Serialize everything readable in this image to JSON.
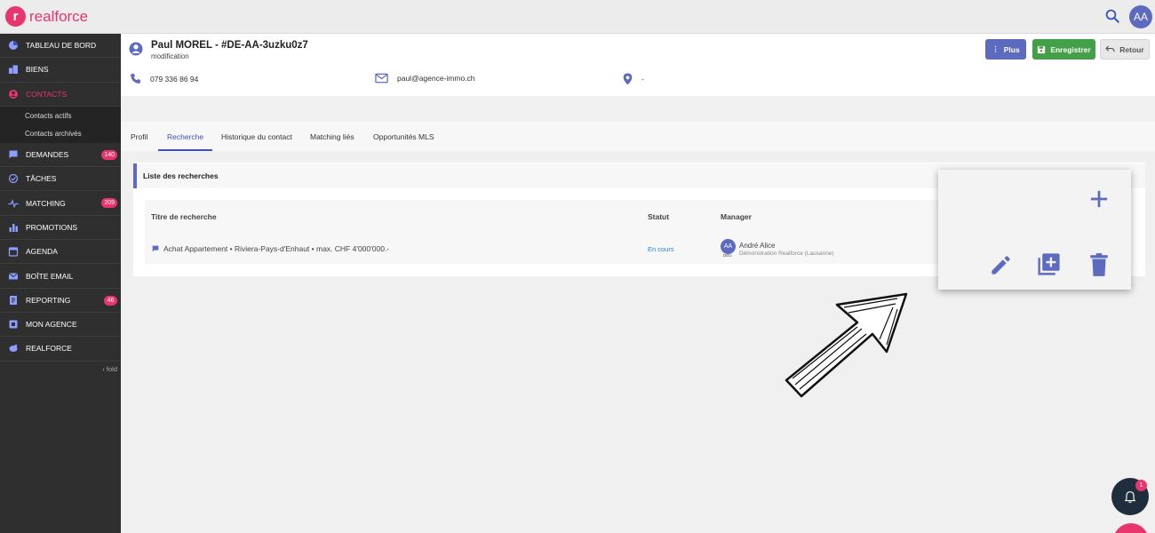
{
  "app": {
    "brand": "realforce",
    "logo_letter": "r",
    "user_initials": "AA"
  },
  "sidebar": {
    "items": [
      {
        "label": "TABLEAU DE BORD",
        "icon": "pie-chart-icon",
        "badge": ""
      },
      {
        "label": "BIENS",
        "icon": "buildings-icon",
        "badge": ""
      },
      {
        "label": "CONTACTS",
        "icon": "account-circle-icon",
        "badge": "",
        "active": true
      },
      {
        "label": "DEMANDES",
        "icon": "message-icon",
        "badge": "140"
      },
      {
        "label": "TÂCHES",
        "icon": "check-circle-icon",
        "badge": ""
      },
      {
        "label": "MATCHING",
        "icon": "pulse-icon",
        "badge": "209"
      },
      {
        "label": "PROMOTIONS",
        "icon": "bar-chart-icon",
        "badge": ""
      },
      {
        "label": "AGENDA",
        "icon": "calendar-icon",
        "badge": ""
      },
      {
        "label": "BOÎTE EMAIL",
        "icon": "mail-icon",
        "badge": ""
      },
      {
        "label": "REPORTING",
        "icon": "document-icon",
        "badge": "46"
      },
      {
        "label": "MON AGENCE",
        "icon": "agency-icon",
        "badge": ""
      },
      {
        "label": "REALFORCE",
        "icon": "piggy-bank-icon",
        "badge": ""
      }
    ],
    "sub_items": [
      "Contacts actifs",
      "Contacts archivés"
    ],
    "fold_label": "fold"
  },
  "header": {
    "title": "Paul MOREL - #DE-AA-3uzku0z7",
    "subtitle": "modification",
    "buttons": {
      "plus": "Plus",
      "save": "Enregistrer",
      "back": "Retour"
    },
    "phone": "079 336 86 94",
    "email": "paul@agence-immo.ch",
    "location": "-"
  },
  "tabs": [
    "Profil",
    "Recherche",
    "Historique du contact",
    "Matching liés",
    "Opportunités MLS"
  ],
  "active_tab": "Recherche",
  "card": {
    "title": "Liste des recherches",
    "columns": {
      "title": "Titre de recherche",
      "status": "Statut",
      "manager": "Manager"
    },
    "row": {
      "title": "Achat Appartement • Riviera-Pays-d'Enhaut • max. CHF 4'000'000.-",
      "status": "En cours",
      "manager_initials": "AA",
      "manager_tag": "DEU",
      "manager_name": "André Alice",
      "manager_org": "Démonstration Realforce (Lausanne)"
    }
  },
  "popup": {
    "icons": [
      "plus-icon",
      "pencil-icon",
      "duplicate-icon",
      "trash-icon"
    ]
  },
  "notifications": {
    "count": "1"
  },
  "colors": {
    "brand": "#e8356d",
    "primary": "#5c6bc0",
    "success": "#43a047",
    "sidebar": "#2f2f2f"
  }
}
